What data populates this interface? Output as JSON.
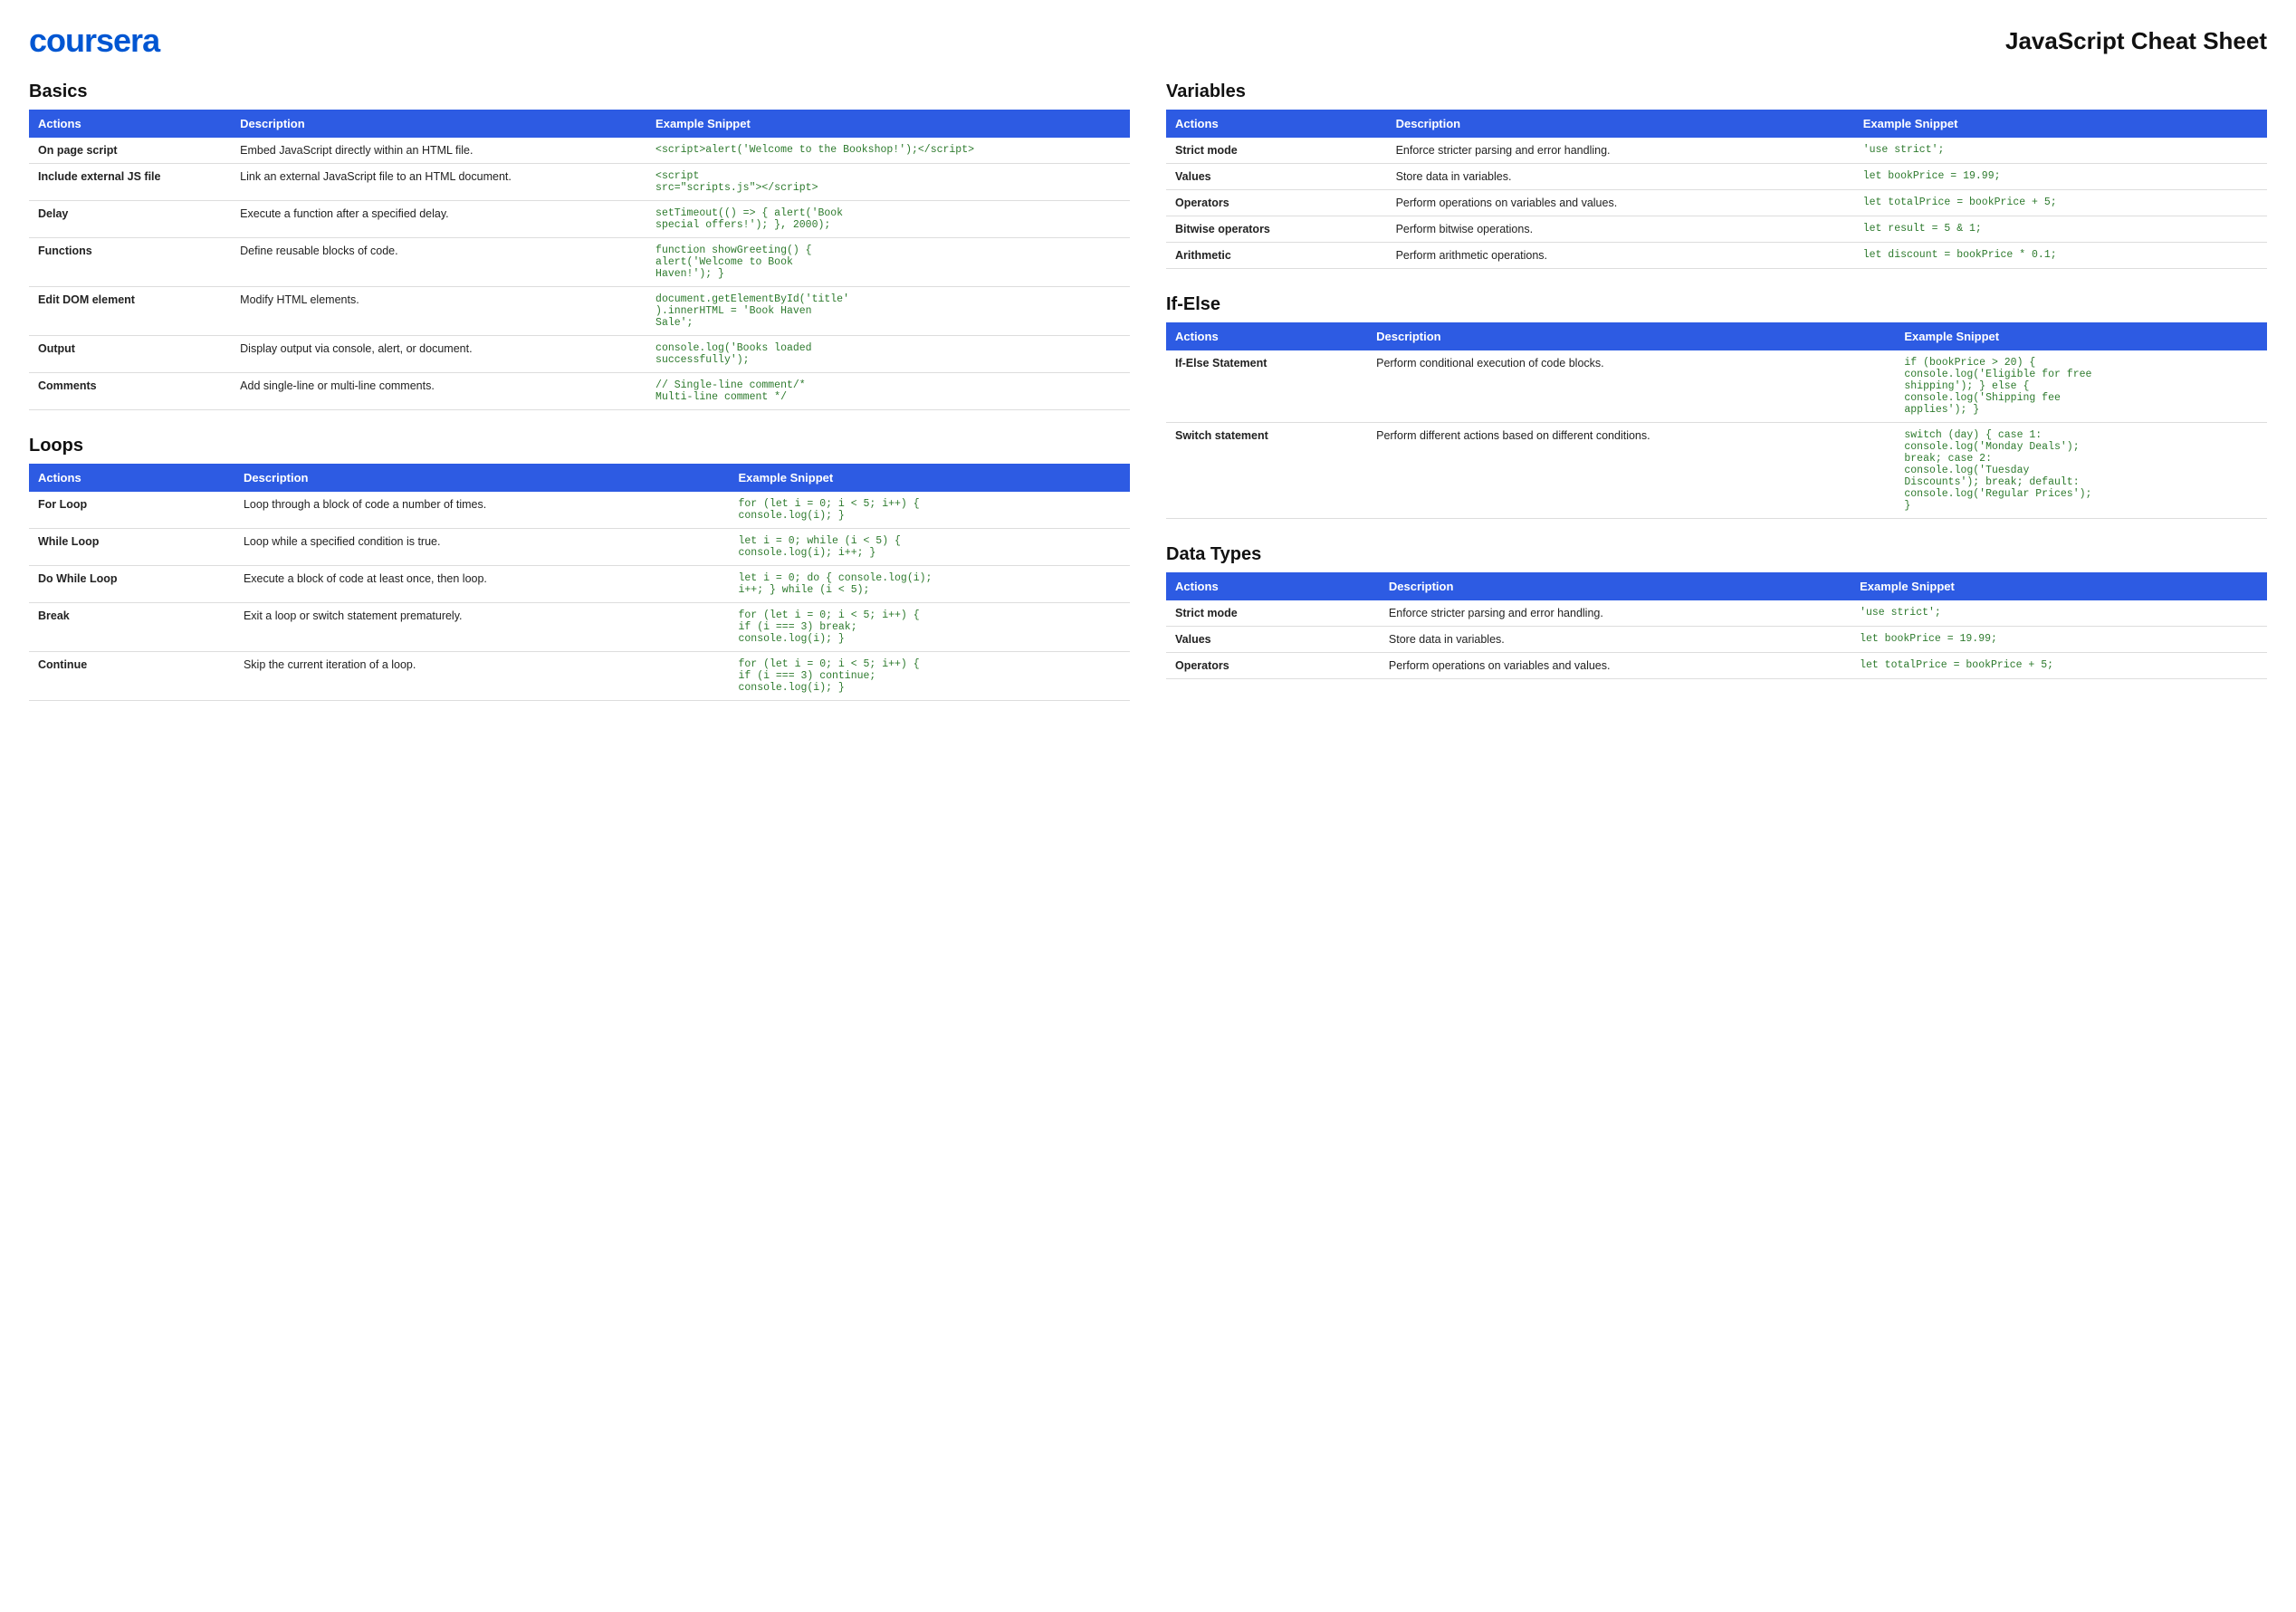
{
  "header": {
    "logo": "coursera",
    "title": "JavaScript Cheat Sheet"
  },
  "sections": {
    "basics": {
      "title": "Basics",
      "columns": [
        "Actions",
        "Description",
        "Example Snippet"
      ],
      "rows": [
        {
          "action": "On page script",
          "description": "Embed JavaScript directly within an HTML file.",
          "snippet": "<script>alert('Welcome to the Bookshop!');</script>"
        },
        {
          "action": "Include external JS file",
          "description": "Link an external JavaScript file to an HTML document.",
          "snippet": "<script\nsrc=\"scripts.js\"></script>"
        },
        {
          "action": "Delay",
          "description": "Execute a function after a specified delay.",
          "snippet": "setTimeout(() => { alert('Book\nspecial offers!'); }, 2000);"
        },
        {
          "action": "Functions",
          "description": "Define reusable blocks of code.",
          "snippet": "function showGreeting() {\nalert('Welcome to Book\nHaven!'); }"
        },
        {
          "action": "Edit DOM element",
          "description": "Modify HTML elements.",
          "snippet": "document.getElementById('title'\n).innerHTML = 'Book Haven\nSale';"
        },
        {
          "action": "Output",
          "description": "Display output via console, alert, or document.",
          "snippet": "console.log('Books loaded\nsuccessfully');"
        },
        {
          "action": "Comments",
          "description": "Add single-line or multi-line comments.",
          "snippet": "// Single-line comment/*\nMulti-line comment */"
        }
      ]
    },
    "loops": {
      "title": "Loops",
      "columns": [
        "Actions",
        "Description",
        "Example Snippet"
      ],
      "rows": [
        {
          "action": "For Loop",
          "description": "Loop through a block of code a number of times.",
          "snippet": "for (let i = 0; i < 5; i++) {\nconsole.log(i); }"
        },
        {
          "action": "While Loop",
          "description": "Loop while a specified condition is true.",
          "snippet": "let i = 0; while (i < 5) {\nconsole.log(i); i++; }"
        },
        {
          "action": "Do While Loop",
          "description": "Execute a block of code at least once, then loop.",
          "snippet": "let i = 0; do { console.log(i);\ni++; } while (i < 5);"
        },
        {
          "action": "Break",
          "description": "Exit a loop or switch statement prematurely.",
          "snippet": "for (let i = 0; i < 5; i++) {\nif (i === 3) break;\nconsole.log(i); }"
        },
        {
          "action": "Continue",
          "description": "Skip the current iteration of a loop.",
          "snippet": "for (let i = 0; i < 5; i++) {\nif (i === 3) continue;\nconsole.log(i); }"
        }
      ]
    },
    "variables": {
      "title": "Variables",
      "columns": [
        "Actions",
        "Description",
        "Example Snippet"
      ],
      "rows": [
        {
          "action": "Strict mode",
          "description": "Enforce stricter parsing and error handling.",
          "snippet": "'use strict';"
        },
        {
          "action": "Values",
          "description": "Store data in variables.",
          "snippet": "let bookPrice = 19.99;"
        },
        {
          "action": "Operators",
          "description": "Perform operations on variables and values.",
          "snippet": "let totalPrice = bookPrice + 5;"
        },
        {
          "action": "Bitwise operators",
          "description": "Perform bitwise operations.",
          "snippet": "let result = 5 & 1;"
        },
        {
          "action": "Arithmetic",
          "description": "Perform arithmetic operations.",
          "snippet": "let discount = bookPrice * 0.1;"
        }
      ]
    },
    "ifelse": {
      "title": "If-Else",
      "columns": [
        "Actions",
        "Description",
        "Example Snippet"
      ],
      "rows": [
        {
          "action": "If-Else Statement",
          "description": "Perform conditional execution of code blocks.",
          "snippet": "if (bookPrice > 20) {\nconsole.log('Eligible for free\nshipping'); } else {\nconsole.log('Shipping fee\napplies'); }"
        },
        {
          "action": "Switch statement",
          "description": "Perform different actions based on different conditions.",
          "snippet": "switch (day) { case 1:\nconsole.log('Monday Deals');\nbreak; case 2:\nconsole.log('Tuesday\nDiscounts'); break; default:\nconsole.log('Regular Prices');\n}"
        }
      ]
    },
    "datatypes": {
      "title": "Data Types",
      "columns": [
        "Actions",
        "Description",
        "Example Snippet"
      ],
      "rows": [
        {
          "action": "Strict mode",
          "description": "Enforce stricter parsing and error handling.",
          "snippet": "'use strict';"
        },
        {
          "action": "Values",
          "description": "Store data in variables.",
          "snippet": "let bookPrice = 19.99;"
        },
        {
          "action": "Operators",
          "description": "Perform operations on variables and values.",
          "snippet": "let totalPrice = bookPrice + 5;"
        }
      ]
    }
  }
}
